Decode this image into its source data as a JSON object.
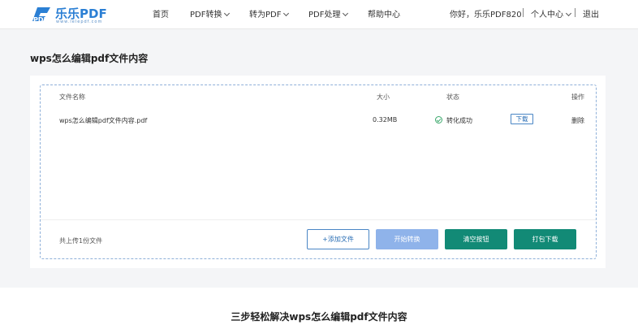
{
  "header": {
    "logo": {
      "brand": "乐乐PDF",
      "domain": "www.lelepdf.com"
    },
    "nav": [
      {
        "label": "首页",
        "dropdown": false
      },
      {
        "label": "PDF转换",
        "dropdown": true
      },
      {
        "label": "转为PDF",
        "dropdown": true
      },
      {
        "label": "PDF处理",
        "dropdown": true
      },
      {
        "label": "帮助中心",
        "dropdown": false
      }
    ],
    "user": {
      "greeting": "你好，乐乐PDF820",
      "center": "个人中心",
      "logout": "退出"
    }
  },
  "page": {
    "title": "wps怎么编辑pdf文件内容"
  },
  "table": {
    "columns": {
      "name": "文件名称",
      "size": "大小",
      "status": "状态",
      "action": "操作"
    },
    "rows": [
      {
        "name": "wps怎么编辑pdf文件内容.pdf",
        "size": "0.32MB",
        "status": "转化成功",
        "download": "下载",
        "delete": "删除"
      }
    ]
  },
  "footer": {
    "count_text": "共上传1份文件",
    "add_label": "+添加文件",
    "start_label": "开始转换",
    "clear_label": "清空按钮",
    "pack_label": "打包下载"
  },
  "section": {
    "title": "三步轻松解决wps怎么编辑pdf文件内容"
  },
  "colors": {
    "brand_blue": "#2b7fd4",
    "accent_green": "#128a76",
    "disabled_blue": "#8fb3ea",
    "success": "#3aa86b"
  }
}
